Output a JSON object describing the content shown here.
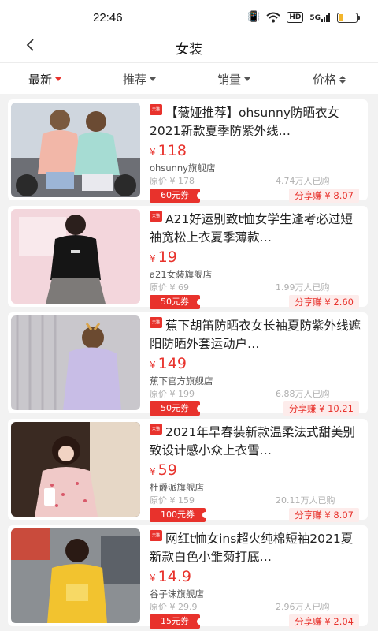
{
  "status_bar": {
    "time": "22:46",
    "hd": "HD",
    "net": "5G",
    "battery_level": 0.25
  },
  "header": {
    "title": "女装"
  },
  "filters": [
    {
      "label": "最新",
      "active": true
    },
    {
      "label": "推荐",
      "active": false
    },
    {
      "label": "销量",
      "active": false
    },
    {
      "label": "价格",
      "active": false
    }
  ],
  "products": [
    {
      "badge": "天猫",
      "title": "【薇娅推荐】ohsunny防晒衣女2021新款夏季防紫外线…",
      "currency": "¥",
      "price": "118",
      "shop": "ohsunny旗舰店",
      "original": "原价 ¥ 178",
      "sold": "4.74万人已购",
      "coupon": "60元券",
      "share": "分享赚 ¥ 8.07"
    },
    {
      "badge": "天猫",
      "title": "A21好运别致t恤女学生逢考必过短袖宽松上衣夏季薄款…",
      "currency": "¥",
      "price": "19",
      "shop": "a21女装旗舰店",
      "original": "原价 ¥ 69",
      "sold": "1.99万人已购",
      "coupon": "50元券",
      "share": "分享赚 ¥ 2.60"
    },
    {
      "badge": "天猫",
      "title": "蕉下胡笛防晒衣女长袖夏防紫外线遮阳防晒外套运动户…",
      "currency": "¥",
      "price": "149",
      "shop": "蕉下官方旗舰店",
      "original": "原价 ¥ 199",
      "sold": "6.88万人已购",
      "coupon": "50元券",
      "share": "分享赚 ¥ 10.21"
    },
    {
      "badge": "天猫",
      "title": "2021年早春装新款温柔法式甜美别致设计感小众上衣雪…",
      "currency": "¥",
      "price": "59",
      "shop": "杜爵派旗舰店",
      "original": "原价 ¥ 159",
      "sold": "20.11万人已购",
      "coupon": "100元券",
      "share": "分享赚 ¥ 8.07"
    },
    {
      "badge": "天猫",
      "title": "网红t恤女ins超火纯棉短袖2021夏新款白色小雏菊打底…",
      "currency": "¥",
      "price": "14.9",
      "shop": "谷子沫旗舰店",
      "original": "原价 ¥ 29.9",
      "sold": "2.96万人已购",
      "coupon": "15元券",
      "share": "分享赚 ¥ 2.04"
    }
  ],
  "colors": {
    "accent": "#e8322c",
    "background": "#f2f2f2"
  }
}
